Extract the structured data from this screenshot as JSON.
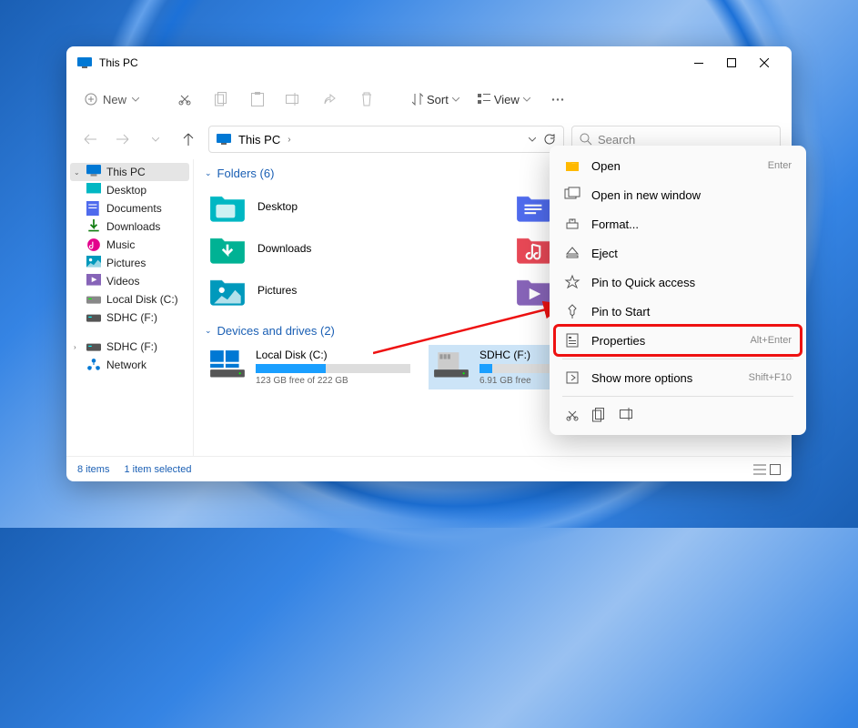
{
  "title": "This PC",
  "toolbar": {
    "new": "New",
    "sort": "Sort",
    "view": "View"
  },
  "breadcrumb": {
    "root": "This PC"
  },
  "search": {
    "placeholder": "Search"
  },
  "sidebar": {
    "items": [
      {
        "label": "This PC",
        "icon": "pc",
        "sel": true
      },
      {
        "label": "Desktop",
        "icon": "desktop"
      },
      {
        "label": "Documents",
        "icon": "documents"
      },
      {
        "label": "Downloads",
        "icon": "downloads"
      },
      {
        "label": "Music",
        "icon": "music"
      },
      {
        "label": "Pictures",
        "icon": "pictures"
      },
      {
        "label": "Videos",
        "icon": "videos"
      },
      {
        "label": "Local Disk (C:)",
        "icon": "disk"
      },
      {
        "label": "SDHC (F:)",
        "icon": "sd"
      }
    ],
    "extra": [
      {
        "label": "SDHC (F:)",
        "icon": "sd"
      },
      {
        "label": "Network",
        "icon": "network"
      }
    ]
  },
  "sections": {
    "folders": {
      "title": "Folders (6)",
      "items": [
        {
          "label": "Desktop",
          "color": "#00b7c3"
        },
        {
          "label": "Documents",
          "color": "#4f6bed"
        },
        {
          "label": "Downloads",
          "color": "#00b294"
        },
        {
          "label": "Music",
          "color": "#e74856"
        },
        {
          "label": "Pictures",
          "color": "#0099bc"
        },
        {
          "label": "Videos",
          "color": "#8764b8"
        }
      ]
    },
    "drives": {
      "title": "Devices and drives (2)",
      "items": [
        {
          "name": "Local Disk (C:)",
          "free": "123 GB free of 222 GB",
          "fill": 45,
          "icon": "windisk"
        },
        {
          "name": "SDHC (F:)",
          "free": "6.91 GB free",
          "fill": 8,
          "icon": "sdcard",
          "sel": true
        }
      ]
    }
  },
  "status": {
    "count": "8 items",
    "sel": "1 item selected"
  },
  "ctx": {
    "items": [
      {
        "label": "Open",
        "sc": "Enter",
        "icon": "open"
      },
      {
        "label": "Open in new window",
        "icon": "newwin"
      },
      {
        "label": "Format...",
        "icon": "format"
      },
      {
        "label": "Eject",
        "icon": "eject"
      },
      {
        "label": "Pin to Quick access",
        "icon": "star"
      },
      {
        "label": "Pin to Start",
        "icon": "pin"
      },
      {
        "label": "Properties",
        "sc": "Alt+Enter",
        "icon": "props",
        "hl": true
      },
      {
        "label": "Show more options",
        "sc": "Shift+F10",
        "icon": "more"
      }
    ]
  }
}
